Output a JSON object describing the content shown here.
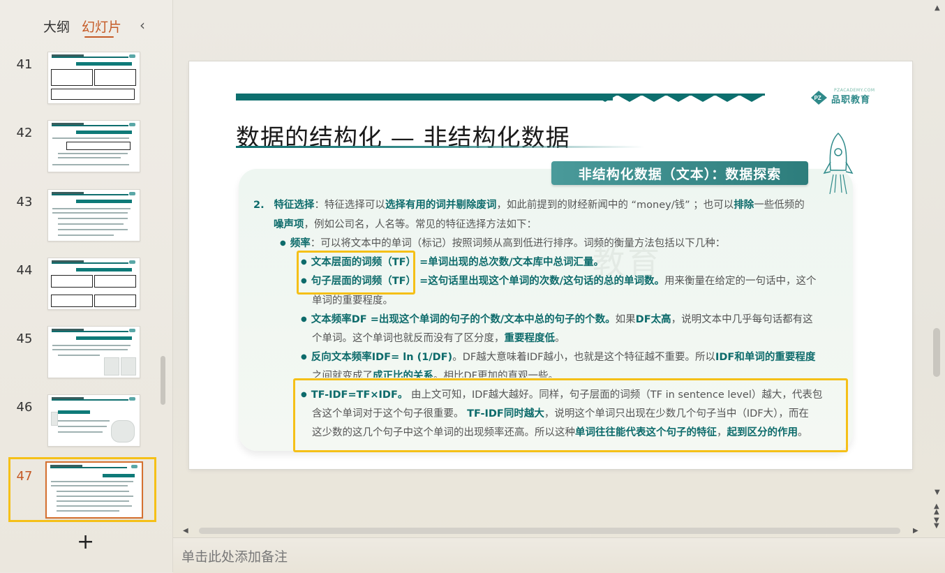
{
  "left_panel": {
    "tabs": {
      "outline": "大纲",
      "slides": "幻灯片"
    },
    "collapse_icon": "‹",
    "add_icon": "+",
    "thumbnails": [
      {
        "number": "41",
        "title": "数据的结构化 — 非结构化数据"
      },
      {
        "number": "42",
        "title": "数据的结构化 — 非结构化数据"
      },
      {
        "number": "43",
        "title": "数据的结构化 — 非结构化数据"
      },
      {
        "number": "44",
        "title": "数据的结构化 — 非结构化数据"
      },
      {
        "number": "45",
        "title": "数据的结构化 — 非结构化数据"
      },
      {
        "number": "46",
        "title": "数据的结构化 — 非结构化数据"
      },
      {
        "number": "47",
        "title": "数据的结构化 — 非结构化数据",
        "active": true
      }
    ]
  },
  "slide": {
    "title": "数据的结构化 — 非结构化数据",
    "subtitle_banner": "非结构化数据（文本）：数据探索",
    "logo_text": "品职教育",
    "logo_small": "PZACADEMY.COM",
    "watermark": "教育",
    "para1": {
      "num": "2.",
      "l1_a": "特征选择",
      "l1_b": "：特征选择可以",
      "l1_c": "选择有用的词并剔除废词",
      "l1_d": "，如此前提到的财经新闻中的 “money/钱” ；也可以",
      "l1_e": "排除",
      "l1_f": "一些低频的",
      "l2_a": "噪声项",
      "l2_b": "，例如公司名，人名等。常见的特征选择方法如下："
    },
    "freq": {
      "a": "频率",
      "b": "：可以将文本中的单词（标记）按照词频从高到低进行排序。词频的衡量方法包括以下几种："
    },
    "tf_doc": {
      "a": "文本层面的词频（TF）",
      "b": " =单词出现的总次数/文本库中总词汇量。"
    },
    "tf_sent": {
      "a": "句子层面的词频（TF）",
      "b": " =这句话里出现这个单词的次数/这句话的总的单词数。",
      "c": "用来衡量在给定的一句话中，这个",
      "d": "单词的重要程度。"
    },
    "df": {
      "a": "文本频率DF =出现这个单词的句子的个数/文本中总的句子的个数。",
      "b": "如果",
      "c": "DF太高",
      "d": "，说明文本中几乎每句话都有这",
      "e": "个单词。这个单词也就反而没有了区分度，",
      "f": "重要程度低",
      "g": "。"
    },
    "idf": {
      "a": "反向文本频率IDF= ln (1/DF)",
      "b": "。DF越大意味着IDF越小，也就是这个特征越不重要。所以",
      "c": "IDF和单词的重要程度",
      "d": "之间就变成了",
      "e": "成正比的关系",
      "f": "。相比DF更加的直观一些。"
    },
    "tfidf": {
      "a": "TF-IDF=TF×IDF。",
      "b": " 由上文可知，IDF越大越好。同样，句子层面的词频（TF in sentence level）越大，代表包",
      "c": "含这个单词对于这个句子很重要。 ",
      "d": "TF-IDF同时越大",
      "e": "，说明这个单词只出现在少数几个句子当中（IDF大），而在",
      "f": "这少数的这几个句子中这个单词的出现频率还高。所以这种",
      "g": "单词往往能代表这个句子的特征",
      "h": "，",
      "i": "起到区分的作用",
      "j": "。"
    }
  },
  "notes": {
    "placeholder": "单击此处添加备注"
  },
  "colors": {
    "accent": "#c55a26",
    "teal": "#0d6b6b",
    "highlight": "#f5c018"
  }
}
